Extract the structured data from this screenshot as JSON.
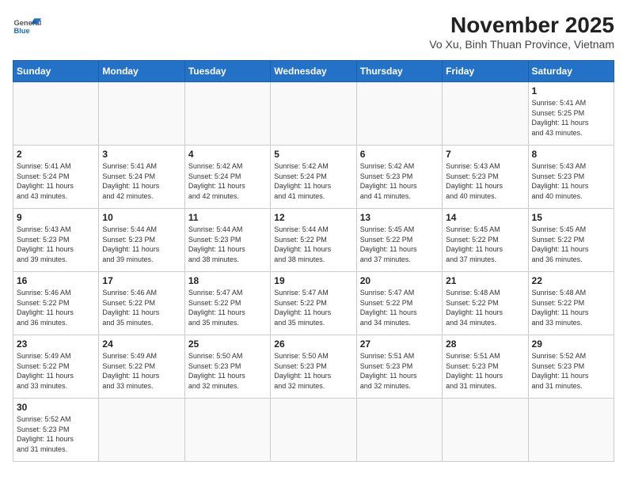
{
  "header": {
    "logo_line1": "General",
    "logo_line2": "Blue",
    "title": "November 2025",
    "subtitle": "Vo Xu, Binh Thuan Province, Vietnam"
  },
  "weekdays": [
    "Sunday",
    "Monday",
    "Tuesday",
    "Wednesday",
    "Thursday",
    "Friday",
    "Saturday"
  ],
  "weeks": [
    [
      {
        "day": "",
        "info": ""
      },
      {
        "day": "",
        "info": ""
      },
      {
        "day": "",
        "info": ""
      },
      {
        "day": "",
        "info": ""
      },
      {
        "day": "",
        "info": ""
      },
      {
        "day": "",
        "info": ""
      },
      {
        "day": "1",
        "info": "Sunrise: 5:41 AM\nSunset: 5:25 PM\nDaylight: 11 hours\nand 43 minutes."
      }
    ],
    [
      {
        "day": "2",
        "info": "Sunrise: 5:41 AM\nSunset: 5:24 PM\nDaylight: 11 hours\nand 43 minutes."
      },
      {
        "day": "3",
        "info": "Sunrise: 5:41 AM\nSunset: 5:24 PM\nDaylight: 11 hours\nand 42 minutes."
      },
      {
        "day": "4",
        "info": "Sunrise: 5:42 AM\nSunset: 5:24 PM\nDaylight: 11 hours\nand 42 minutes."
      },
      {
        "day": "5",
        "info": "Sunrise: 5:42 AM\nSunset: 5:24 PM\nDaylight: 11 hours\nand 41 minutes."
      },
      {
        "day": "6",
        "info": "Sunrise: 5:42 AM\nSunset: 5:23 PM\nDaylight: 11 hours\nand 41 minutes."
      },
      {
        "day": "7",
        "info": "Sunrise: 5:43 AM\nSunset: 5:23 PM\nDaylight: 11 hours\nand 40 minutes."
      },
      {
        "day": "8",
        "info": "Sunrise: 5:43 AM\nSunset: 5:23 PM\nDaylight: 11 hours\nand 40 minutes."
      }
    ],
    [
      {
        "day": "9",
        "info": "Sunrise: 5:43 AM\nSunset: 5:23 PM\nDaylight: 11 hours\nand 39 minutes."
      },
      {
        "day": "10",
        "info": "Sunrise: 5:44 AM\nSunset: 5:23 PM\nDaylight: 11 hours\nand 39 minutes."
      },
      {
        "day": "11",
        "info": "Sunrise: 5:44 AM\nSunset: 5:23 PM\nDaylight: 11 hours\nand 38 minutes."
      },
      {
        "day": "12",
        "info": "Sunrise: 5:44 AM\nSunset: 5:22 PM\nDaylight: 11 hours\nand 38 minutes."
      },
      {
        "day": "13",
        "info": "Sunrise: 5:45 AM\nSunset: 5:22 PM\nDaylight: 11 hours\nand 37 minutes."
      },
      {
        "day": "14",
        "info": "Sunrise: 5:45 AM\nSunset: 5:22 PM\nDaylight: 11 hours\nand 37 minutes."
      },
      {
        "day": "15",
        "info": "Sunrise: 5:45 AM\nSunset: 5:22 PM\nDaylight: 11 hours\nand 36 minutes."
      }
    ],
    [
      {
        "day": "16",
        "info": "Sunrise: 5:46 AM\nSunset: 5:22 PM\nDaylight: 11 hours\nand 36 minutes."
      },
      {
        "day": "17",
        "info": "Sunrise: 5:46 AM\nSunset: 5:22 PM\nDaylight: 11 hours\nand 35 minutes."
      },
      {
        "day": "18",
        "info": "Sunrise: 5:47 AM\nSunset: 5:22 PM\nDaylight: 11 hours\nand 35 minutes."
      },
      {
        "day": "19",
        "info": "Sunrise: 5:47 AM\nSunset: 5:22 PM\nDaylight: 11 hours\nand 35 minutes."
      },
      {
        "day": "20",
        "info": "Sunrise: 5:47 AM\nSunset: 5:22 PM\nDaylight: 11 hours\nand 34 minutes."
      },
      {
        "day": "21",
        "info": "Sunrise: 5:48 AM\nSunset: 5:22 PM\nDaylight: 11 hours\nand 34 minutes."
      },
      {
        "day": "22",
        "info": "Sunrise: 5:48 AM\nSunset: 5:22 PM\nDaylight: 11 hours\nand 33 minutes."
      }
    ],
    [
      {
        "day": "23",
        "info": "Sunrise: 5:49 AM\nSunset: 5:22 PM\nDaylight: 11 hours\nand 33 minutes."
      },
      {
        "day": "24",
        "info": "Sunrise: 5:49 AM\nSunset: 5:22 PM\nDaylight: 11 hours\nand 33 minutes."
      },
      {
        "day": "25",
        "info": "Sunrise: 5:50 AM\nSunset: 5:23 PM\nDaylight: 11 hours\nand 32 minutes."
      },
      {
        "day": "26",
        "info": "Sunrise: 5:50 AM\nSunset: 5:23 PM\nDaylight: 11 hours\nand 32 minutes."
      },
      {
        "day": "27",
        "info": "Sunrise: 5:51 AM\nSunset: 5:23 PM\nDaylight: 11 hours\nand 32 minutes."
      },
      {
        "day": "28",
        "info": "Sunrise: 5:51 AM\nSunset: 5:23 PM\nDaylight: 11 hours\nand 31 minutes."
      },
      {
        "day": "29",
        "info": "Sunrise: 5:52 AM\nSunset: 5:23 PM\nDaylight: 11 hours\nand 31 minutes."
      }
    ],
    [
      {
        "day": "30",
        "info": "Sunrise: 5:52 AM\nSunset: 5:23 PM\nDaylight: 11 hours\nand 31 minutes."
      },
      {
        "day": "",
        "info": ""
      },
      {
        "day": "",
        "info": ""
      },
      {
        "day": "",
        "info": ""
      },
      {
        "day": "",
        "info": ""
      },
      {
        "day": "",
        "info": ""
      },
      {
        "day": "",
        "info": ""
      }
    ]
  ]
}
